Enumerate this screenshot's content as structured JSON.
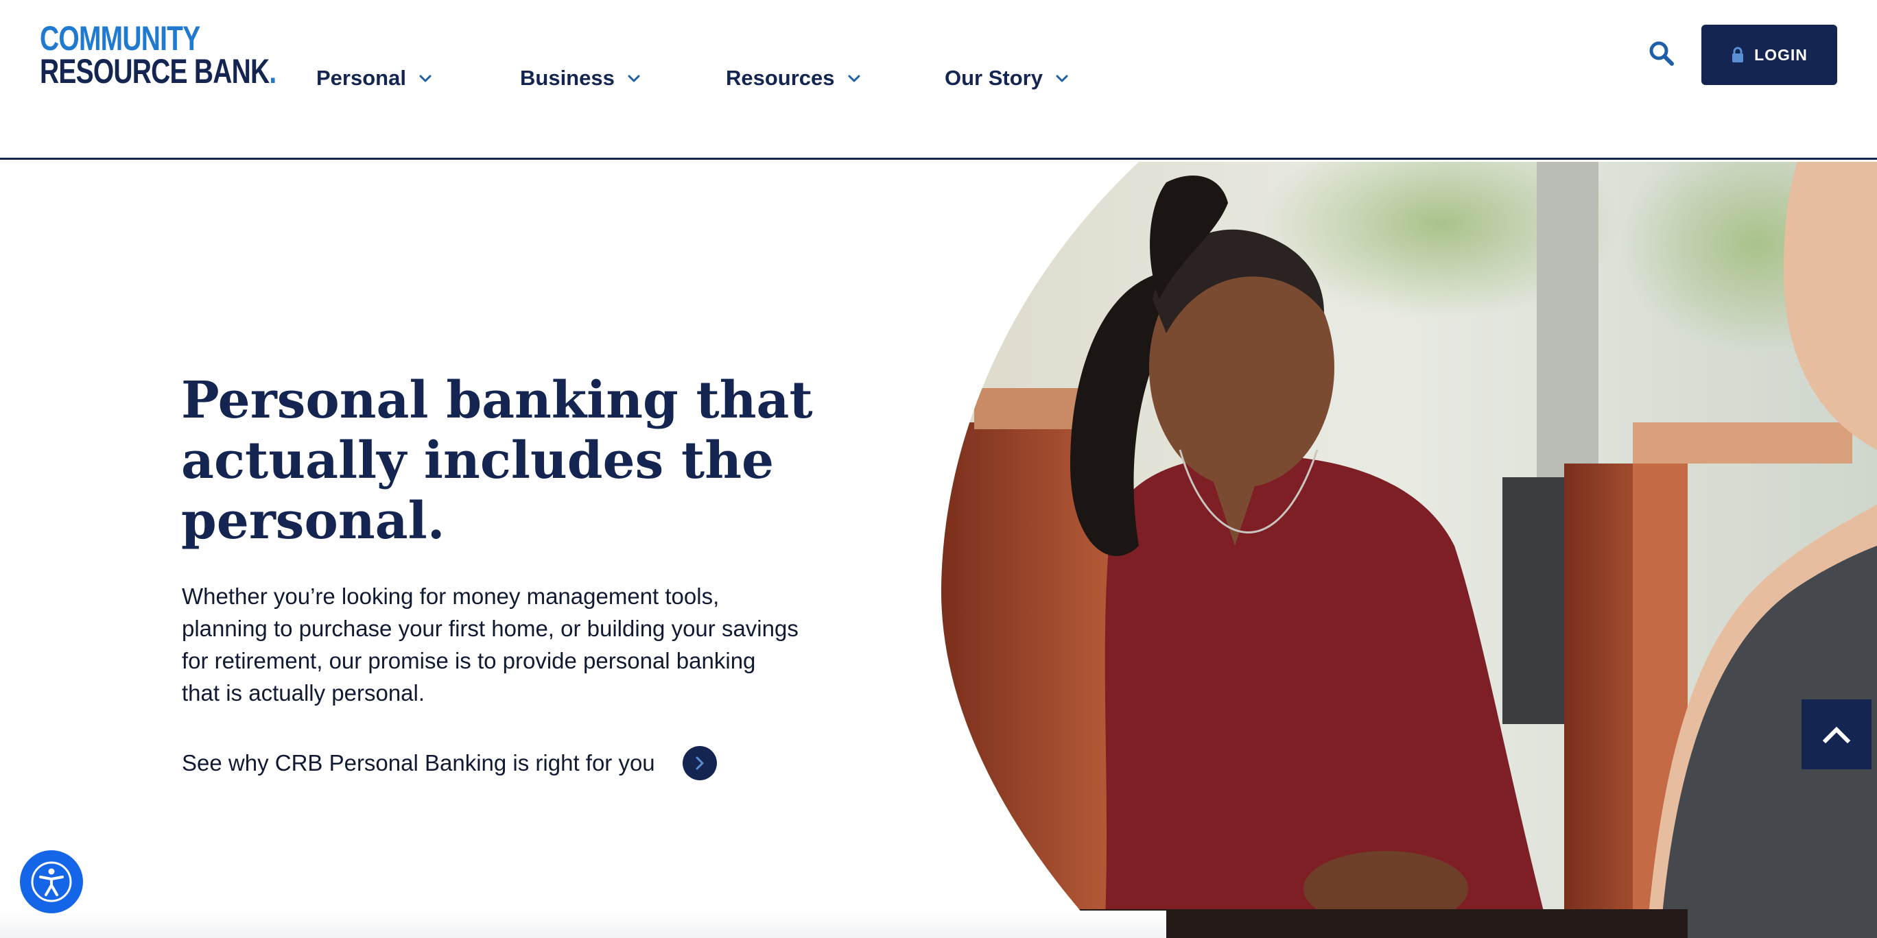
{
  "brand": {
    "logo_line1": "COMMUNITY",
    "logo_line2": "RESOURCE BANK",
    "logo_dot": ".",
    "primary_color": "#132550",
    "accent_color": "#1f7ad0"
  },
  "nav": {
    "items": [
      {
        "label": "Personal",
        "icon": "chevron-down-icon"
      },
      {
        "label": "Business",
        "icon": "chevron-down-icon"
      },
      {
        "label": "Resources",
        "icon": "chevron-down-icon"
      },
      {
        "label": "Our Story",
        "icon": "chevron-down-icon"
      }
    ]
  },
  "header": {
    "search_icon": "search-icon",
    "login_label": "LOGIN",
    "login_icon": "lock-icon"
  },
  "hero": {
    "title": "Personal banking that actually includes the personal.",
    "description": "Whether you’re looking for money management tools, planning to purchase your first home, or building your savings for retirement, our promise is to provide personal banking that is actually personal.",
    "cta_label": "See why CRB Personal Banking is right for you",
    "cta_icon": "chevron-right-icon",
    "image_subject": "smiling customer in maroon top at bank teller counter"
  },
  "floating": {
    "scroll_top_icon": "chevron-up-icon",
    "accessibility_icon": "accessibility-icon",
    "accessibility_color": "#1565e8"
  }
}
